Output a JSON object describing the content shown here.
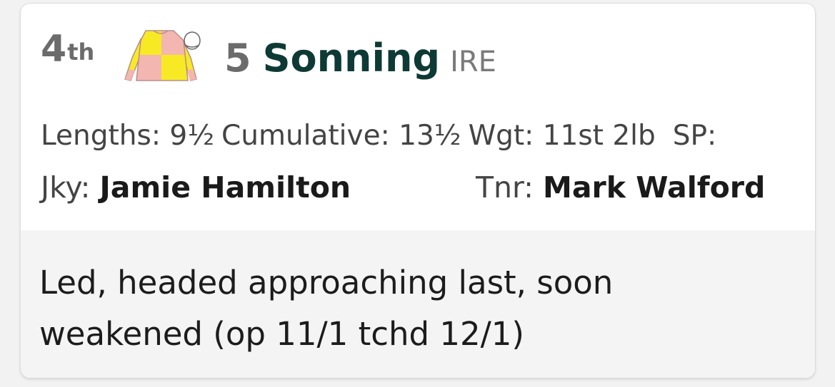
{
  "result": {
    "position": "4",
    "position_suffix": "th",
    "runner_number": "5",
    "horse_name": "Sonning",
    "country": "IRE",
    "silks_icon": "jockey-silks-icon",
    "silks_colors": {
      "pink": "#f4b6b0",
      "yellow": "#f7ea25",
      "cap": "#ffffff"
    }
  },
  "stats": {
    "lengths": "Lengths: 9½",
    "cumulative": "Cumulative: 13½",
    "weight": "Wgt: 11st 2lb",
    "sp": "SP: "
  },
  "people": {
    "jockey_label": "Jky:",
    "jockey_name": "Jamie Hamilton",
    "trainer_label": "Tnr:",
    "trainer_name": "Mark Walford"
  },
  "comment": "Led, headed approaching last, soon weakened (op 11/1 tchd 12/1)"
}
